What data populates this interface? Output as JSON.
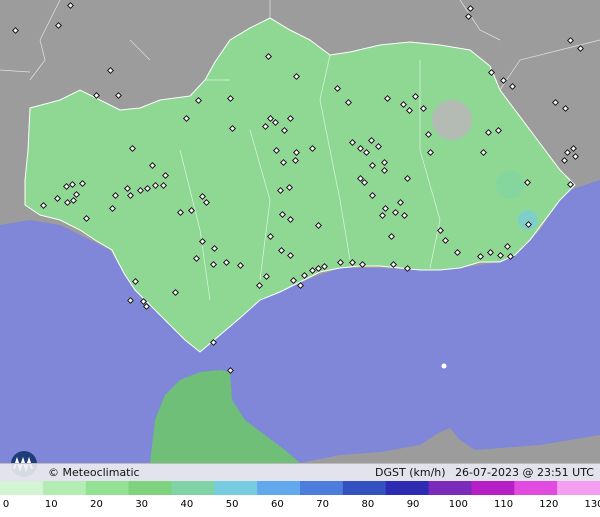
{
  "map": {
    "variable": "DGST (km/h)",
    "datetime": "26-07-2023 @ 23:51 UTC",
    "credit": "© Meteoclimatic",
    "colors": {
      "sea": "#8086d8",
      "land_main": "#8fd894",
      "land_outside": "#9c9c9c",
      "land_africa": "#6fbf78",
      "border": "#ffffff"
    }
  },
  "scale": {
    "unit": "km/h",
    "ticks": [
      "0",
      "10",
      "20",
      "30",
      "40",
      "50",
      "60",
      "70",
      "80",
      "90",
      "100",
      "110",
      "120",
      "130"
    ],
    "colors": [
      "#d4f5d4",
      "#b4edb4",
      "#93e193",
      "#7fd37f",
      "#7fd3a6",
      "#78cce0",
      "#62a8ec",
      "#4d7ddc",
      "#3451c0",
      "#2d2bb2",
      "#7a2bbb",
      "#b61ec7",
      "#e24bdf",
      "#f39ef1"
    ]
  }
}
